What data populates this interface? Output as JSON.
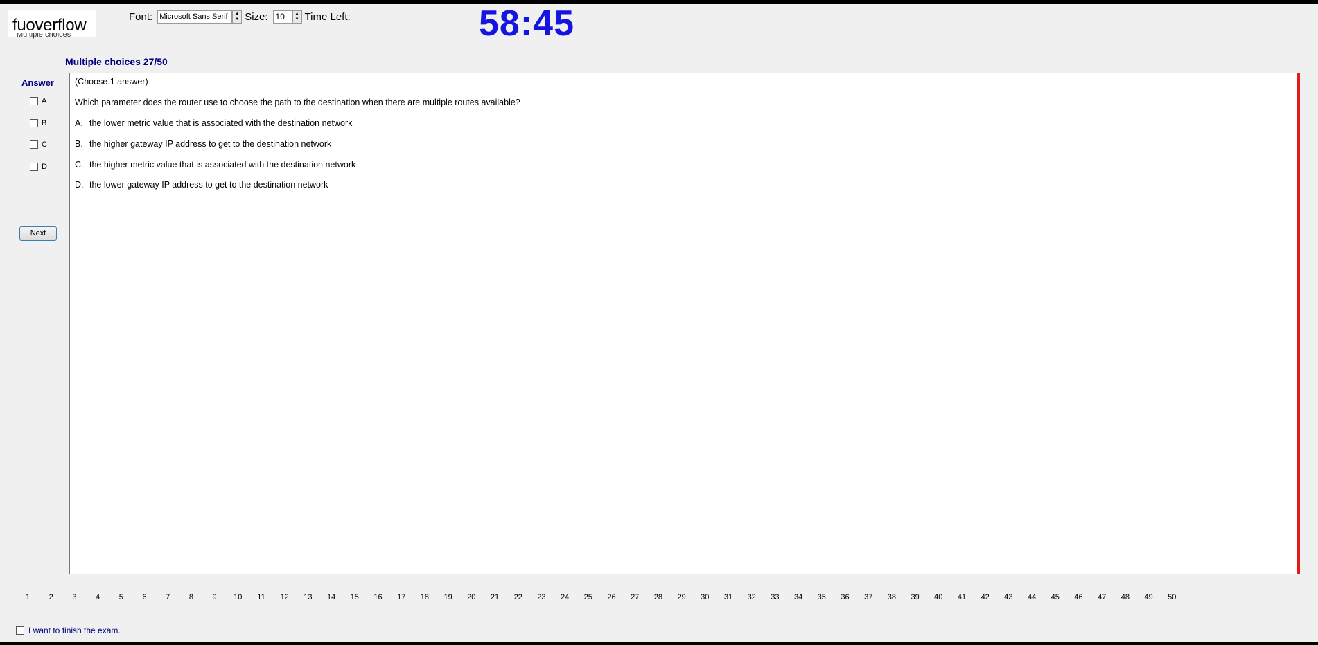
{
  "app": {
    "logo": "fuoverflow",
    "section_hint": "Multiple choices"
  },
  "toolbar": {
    "font_label": "Font:",
    "font_value": "Microsoft Sans Serif",
    "size_label": "Size:",
    "size_value": "10",
    "time_left_label": "Time Left:",
    "time_left_value": "58:45"
  },
  "question": {
    "header": "Multiple choices 27/50",
    "instruction": "(Choose 1 answer)",
    "text": "Which parameter does the router use to choose the path to the destination when there are multiple routes available?",
    "options": [
      {
        "letter": "A.",
        "text": "the lower metric value that is associated with the destination network"
      },
      {
        "letter": "B.",
        "text": "the higher gateway IP address to get to the destination network"
      },
      {
        "letter": "C.",
        "text": "the higher metric value that is associated with the destination network"
      },
      {
        "letter": "D.",
        "text": "the lower gateway IP address to get to the destination network"
      }
    ]
  },
  "answer_panel": {
    "label": "Answer",
    "choices": [
      "A",
      "B",
      "C",
      "D"
    ],
    "next_label": "Next"
  },
  "navigation": {
    "pages": [
      "1",
      "2",
      "3",
      "4",
      "5",
      "6",
      "7",
      "8",
      "9",
      "10",
      "11",
      "12",
      "13",
      "14",
      "15",
      "16",
      "17",
      "18",
      "19",
      "20",
      "21",
      "22",
      "23",
      "24",
      "25",
      "26",
      "27",
      "28",
      "29",
      "30",
      "31",
      "32",
      "33",
      "34",
      "35",
      "36",
      "37",
      "38",
      "39",
      "40",
      "41",
      "42",
      "43",
      "44",
      "45",
      "46",
      "47",
      "48",
      "49",
      "50"
    ]
  },
  "finish": {
    "label": "I want to finish the exam."
  },
  "colors": {
    "accent": "#000080",
    "timer": "#1515e0",
    "panel_edge": "#e31b1b"
  }
}
